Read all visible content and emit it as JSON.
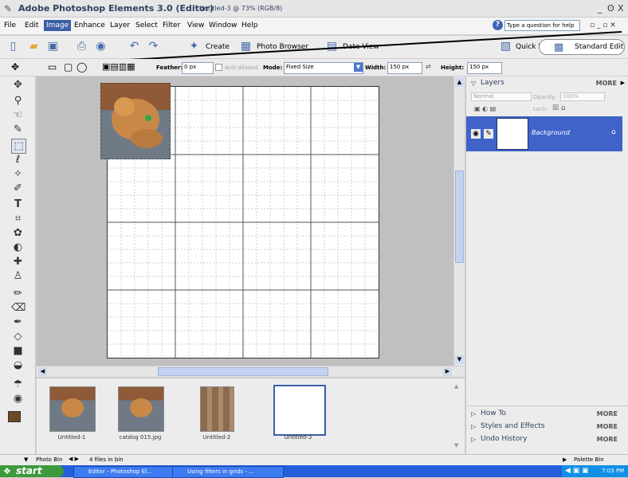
{
  "app": {
    "title": "Adobe Photoshop Elements 3.0 (Editor)",
    "doc": "Untitled-3 @ 73% (RGB/8)",
    "controls": [
      "_",
      "ʘ",
      "X"
    ]
  },
  "menu": {
    "items": [
      "File",
      "Edit",
      "Image",
      "Enhance",
      "Layer",
      "Select",
      "Filter",
      "View",
      "Window",
      "Help"
    ],
    "help_placeholder": "Type a question for help"
  },
  "shortcuts": {
    "create": "Create",
    "photo_browser": "Photo Browser",
    "date_view": "Date View",
    "quick_fix": "Quick Fix",
    "standard_edit": "Standard Edit"
  },
  "options": {
    "feather_label": "Feather:",
    "feather_value": "0 px",
    "anti_aliased": "Anti-aliased",
    "mode_label": "Mode:",
    "mode_value": "Fixed Size",
    "width_label": "Width:",
    "width_value": "150 px",
    "height_label": "Height:",
    "height_value": "150 px"
  },
  "photobin": {
    "items": [
      {
        "label": "Untitled-1"
      },
      {
        "label": "catdog 015.jpg"
      },
      {
        "label": "Untitled-2"
      },
      {
        "label": "Untitled-3"
      }
    ]
  },
  "palette": {
    "layers_title": "Layers",
    "more": "MORE",
    "blend_mode": "Normal",
    "opacity_label": "Opacity:",
    "opacity_value": "100%",
    "lock_label": "Lock:",
    "layer_name": "Background",
    "how_to": "How To",
    "styles_effects": "Styles and Effects",
    "undo_history": "Undo History"
  },
  "status": {
    "photo_bin": "Photo Bin",
    "files": "4 files in bin",
    "palette_bin": "Palette Bin"
  },
  "taskbar": {
    "start": "start",
    "task1": "Editor - Photoshop El...",
    "task2": "Using filters in grids - ...",
    "time": "7:03 PM"
  }
}
